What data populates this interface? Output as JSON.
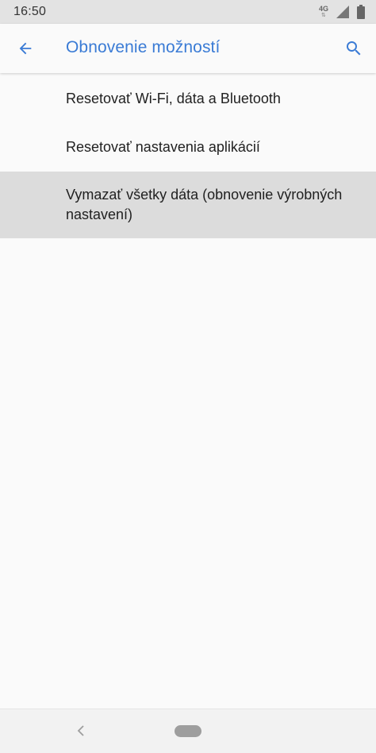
{
  "status_bar": {
    "time": "16:50",
    "network_type": "4G",
    "icons": [
      "network-4g-icon",
      "signal-icon",
      "battery-icon"
    ]
  },
  "app_bar": {
    "title": "Obnovenie možností",
    "back_icon": "arrow-left-icon",
    "search_icon": "search-icon",
    "accent_color": "#3a7bd5"
  },
  "options": [
    {
      "label": "Resetovať Wi-Fi, dáta a Bluetooth"
    },
    {
      "label": "Resetovať nastavenia aplikácií"
    },
    {
      "label": "Vymazať všetky dáta (obnovenie výrobných nastavení)",
      "highlighted": true
    }
  ],
  "nav_bar": {
    "icons": [
      "nav-back-icon",
      "nav-home-pill"
    ]
  }
}
